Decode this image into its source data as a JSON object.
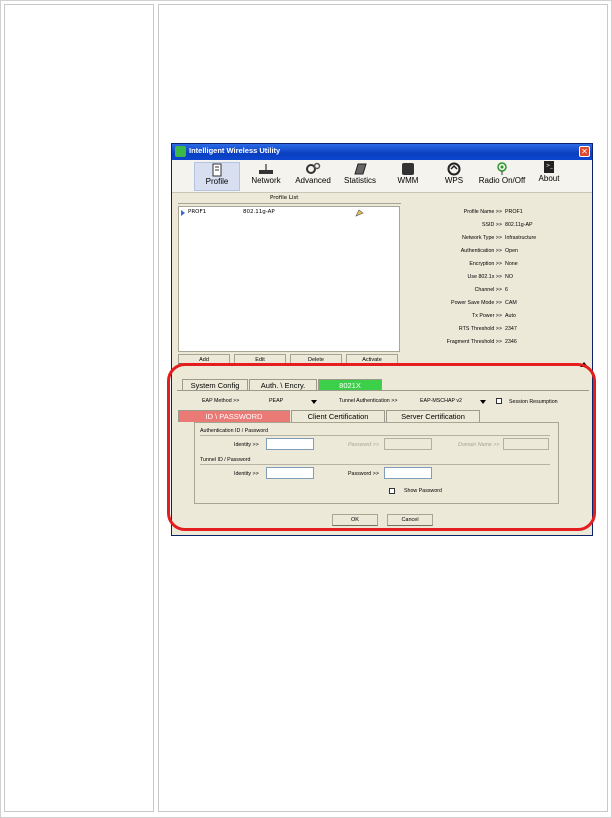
{
  "window": {
    "title": "Intelligent Wireless Utility",
    "close": "✕"
  },
  "toolbar": [
    {
      "label": "Profile",
      "icon": "profile-icon"
    },
    {
      "label": "Network",
      "icon": "network-icon"
    },
    {
      "label": "Advanced",
      "icon": "advanced-icon"
    },
    {
      "label": "Statistics",
      "icon": "statistics-icon"
    },
    {
      "label": "WMM",
      "icon": "wmm-icon"
    },
    {
      "label": "WPS",
      "icon": "wps-icon"
    },
    {
      "label": "Radio On/Off",
      "icon": "radio-icon"
    },
    {
      "label": "About",
      "icon": "about-icon"
    }
  ],
  "profile_list": {
    "title": "Profile List",
    "rows": [
      {
        "name": "PROF1",
        "ssid": "802.11g-AP"
      }
    ],
    "buttons": [
      "Add",
      "Edit",
      "Delete",
      "Activate"
    ]
  },
  "details": [
    {
      "k": "Profile Name >>",
      "v": "PROF1"
    },
    {
      "k": "SSID >>",
      "v": "802.11g-AP"
    },
    {
      "k": "Network Type >>",
      "v": "Infrastructure"
    },
    {
      "k": "Authentication >>",
      "v": "Open"
    },
    {
      "k": "Encryption >>",
      "v": "None"
    },
    {
      "k": "Use 802.1x >>",
      "v": "NO"
    },
    {
      "k": "Channel >>",
      "v": "6"
    },
    {
      "k": "Power Save Mode >>",
      "v": "CAM"
    },
    {
      "k": "Tx Power >>",
      "v": "Auto"
    },
    {
      "k": "RTS Threshold >>",
      "v": "2347"
    },
    {
      "k": "Fragment Threshold >>",
      "v": "2346"
    }
  ],
  "tabs": [
    "System Config",
    "Auth. \\ Encry.",
    "8021X"
  ],
  "eap": {
    "method_label": "EAP Method >>",
    "method_value": "PEAP",
    "tunnel_label": "Tunnel Authentication >>",
    "tunnel_value": "EAP-MSCHAP v2",
    "session_resumption": "Session Resumption"
  },
  "subtabs": [
    "ID \\ PASSWORD",
    "Client Certification",
    "Server Certification"
  ],
  "auth_group": {
    "title": "Authentication ID / Password",
    "identity": "Identity >>",
    "password": "Password >>",
    "domain": "Domain Name >>"
  },
  "tunnel_group": {
    "title": "Tunnel ID / Password",
    "identity": "Identity >>",
    "password": "Password >>",
    "show_password": "Show Password"
  },
  "footer": {
    "ok": "OK",
    "cancel": "Cancel"
  },
  "colors": {
    "active_tab": "#3ccf4a",
    "active_subtab": "#ea7a76",
    "highlight_ring": "#e41e1e"
  }
}
